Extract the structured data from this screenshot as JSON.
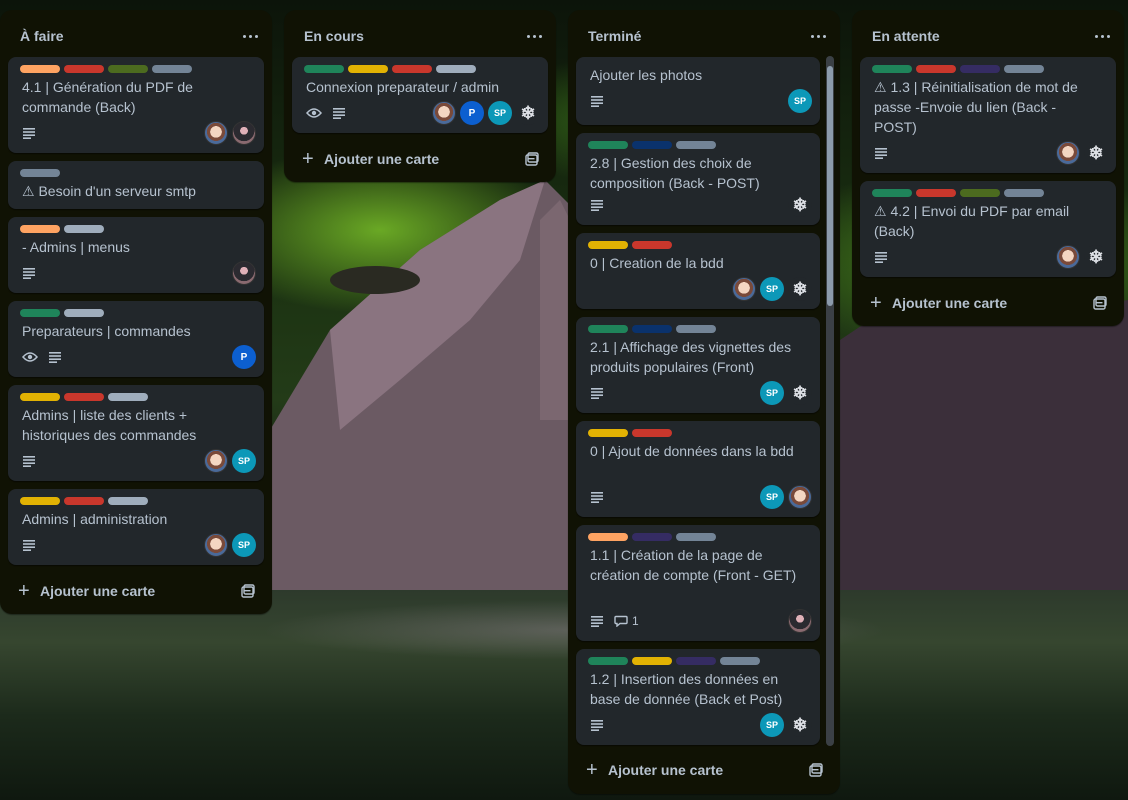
{
  "colors": {
    "orange": "#fea362",
    "red": "#c9372c",
    "olive": "#4c6b1f",
    "gray": "#738496",
    "lightgray": "#9fadbc",
    "green": "#1f845a",
    "yellow": "#e2b203",
    "navy": "#0a326c",
    "purple": "#352c63",
    "listbg": "#101204",
    "cardbg": "#22272b"
  },
  "lists": [
    {
      "title": "À faire",
      "add_label": "Ajouter une carte",
      "cards": [
        {
          "labels": [
            "orange",
            "red",
            "olive",
            "gray"
          ],
          "title": "4.1 | Génération du PDF de commande (Back)",
          "badges": [
            "description-icon"
          ],
          "members": [
            "photo",
            "dark"
          ]
        },
        {
          "labels": [
            "gray"
          ],
          "title": "⚠ Besoin d'un serveur smtp",
          "badges": [],
          "members": []
        },
        {
          "labels": [
            "orange",
            "lightgray"
          ],
          "title": "- Admins | menus",
          "badges": [
            "description-icon"
          ],
          "members": [
            "dark"
          ]
        },
        {
          "labels": [
            "green",
            "lightgray"
          ],
          "title": "Preparateurs | commandes",
          "badges": [
            "eye-icon",
            "description-icon"
          ],
          "members": [
            "P"
          ]
        },
        {
          "labels": [
            "yellow",
            "red",
            "lightgray"
          ],
          "title": "Admins | liste des clients + historiques des commandes",
          "badges": [
            "description-icon"
          ],
          "members": [
            "photo",
            "SP"
          ]
        },
        {
          "labels": [
            "yellow",
            "red",
            "lightgray"
          ],
          "title": "Admins | administration",
          "badges": [
            "description-icon"
          ],
          "members": [
            "photo",
            "SP"
          ]
        }
      ]
    },
    {
      "title": "En cours",
      "add_label": "Ajouter une carte",
      "cards": [
        {
          "labels": [
            "green",
            "yellow",
            "red",
            "lightgray"
          ],
          "title": "Connexion preparateur / admin",
          "badges": [
            "eye-icon",
            "description-icon"
          ],
          "members": [
            "photo",
            "P",
            "SP",
            "gear"
          ]
        }
      ]
    },
    {
      "title": "Terminé",
      "add_label": "Ajouter une carte",
      "cards": [
        {
          "labels": [],
          "title": "Ajouter les photos",
          "badges": [
            "description-icon"
          ],
          "members": [
            "SP"
          ]
        },
        {
          "labels": [
            "green",
            "navy",
            "gray"
          ],
          "title": "2.8 | Gestion des choix de composition (Back - POST)",
          "badges": [
            "description-icon"
          ],
          "members": [
            "gear"
          ]
        },
        {
          "labels": [
            "yellow",
            "red"
          ],
          "title": "0 | Creation de la bdd",
          "badges": [],
          "members": [
            "photo",
            "SP",
            "gear"
          ]
        },
        {
          "labels": [
            "green",
            "navy",
            "gray"
          ],
          "title": "2.1 | Affichage des vignettes des produits populaires (Front)",
          "badges": [
            "description-icon"
          ],
          "members": [
            "SP",
            "gear"
          ]
        },
        {
          "labels": [
            "yellow",
            "red"
          ],
          "title": "0 | Ajout de données dans la bdd",
          "badges": [
            "description-icon"
          ],
          "members": [
            "SP",
            "photo"
          ]
        },
        {
          "labels": [
            "orange",
            "purple",
            "gray"
          ],
          "title": "1.1 | Création de la page de création de compte (Front - GET)",
          "badges": [
            "description-icon",
            "comment-icon"
          ],
          "comment_count": "1",
          "members": [
            "dark"
          ]
        },
        {
          "labels": [
            "green",
            "yellow",
            "purple",
            "gray"
          ],
          "title": "1.2 | Insertion des données en base de donnée (Back et Post)",
          "badges": [
            "description-icon"
          ],
          "members": [
            "SP",
            "gear"
          ]
        }
      ]
    },
    {
      "title": "En attente",
      "add_label": "Ajouter une carte",
      "cards": [
        {
          "labels": [
            "green",
            "red",
            "purple",
            "gray"
          ],
          "title": "⚠ 1.3 | Réinitialisation de mot de passe -Envoie du lien (Back - POST)",
          "badges": [
            "description-icon"
          ],
          "members": [
            "photo",
            "gear"
          ]
        },
        {
          "labels": [
            "green",
            "red",
            "olive",
            "gray"
          ],
          "title": "⚠ 4.2 | Envoi du PDF par email (Back)",
          "badges": [
            "description-icon"
          ],
          "members": [
            "photo",
            "gear"
          ]
        }
      ]
    }
  ],
  "member_initials": {
    "SP": "SP",
    "P": "P"
  }
}
